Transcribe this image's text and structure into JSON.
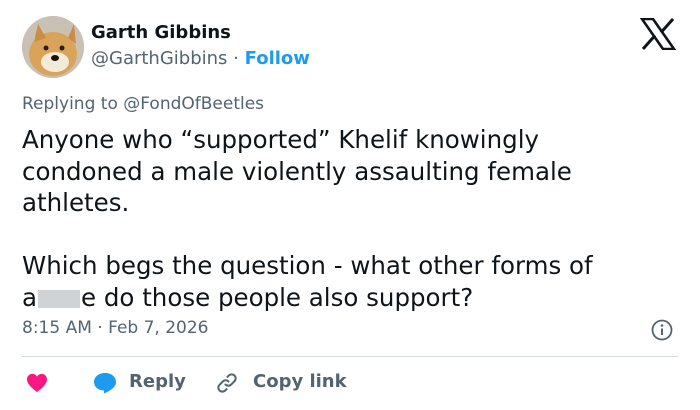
{
  "author": {
    "name": "Garth Gibbins",
    "handle": "@GarthGibbins",
    "separator": "·",
    "follow_label": "Follow"
  },
  "reply_context": {
    "prefix": "Replying to",
    "mention": "@FondOfBeetles"
  },
  "tweet": {
    "line1": "Anyone who “supported” Khelif knowingly",
    "line2": "condoned a male violently assaulting female",
    "line3": "athletes.",
    "line4": "Which begs the question - what other forms of",
    "line5_start": "a",
    "line5_end": "e do those people also support?"
  },
  "meta": {
    "time": "8:15 AM",
    "separator": "·",
    "date": "Feb 7, 2026"
  },
  "actions": {
    "reply_label": "Reply",
    "copy_link_label": "Copy link"
  },
  "icons": {
    "logo": "x-logo-icon",
    "info": "info-icon",
    "like": "heart-icon",
    "reply": "reply-bubble-icon",
    "copy": "link-icon"
  },
  "colors": {
    "accent": "#1d9bf0",
    "heart": "#f91880",
    "muted": "#536471",
    "text": "#0f1419"
  }
}
